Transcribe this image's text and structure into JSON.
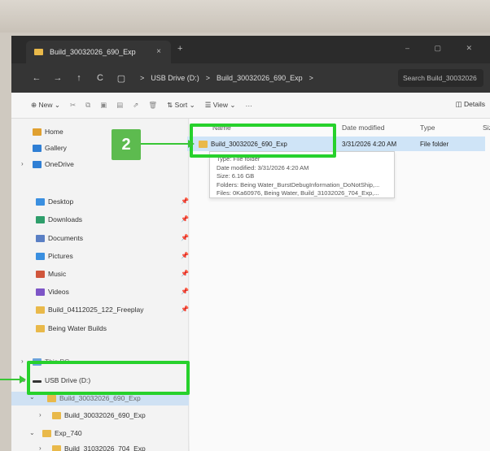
{
  "window": {
    "tab_title": "Build_30032026_690_Exp",
    "tab_close": "×",
    "new_tab": "+",
    "controls": "–  ▢  ✕"
  },
  "address": {
    "back": "←",
    "forward": "→",
    "up": "↑",
    "refresh": "C",
    "monitor": "▢",
    "crumbs": [
      ">",
      "USB Drive (D:)",
      ">",
      "Build_30032026_690_Exp",
      ">"
    ],
    "search_placeholder": "Search Build_30032026"
  },
  "toolbar": {
    "new_label": "New",
    "sort_label": "Sort",
    "view_label": "View",
    "more_label": "···",
    "details_label": "Details"
  },
  "sidebar": {
    "home": "Home",
    "gallery": "Gallery",
    "onedrive": "OneDrive",
    "quick": [
      {
        "label": "Desktop",
        "color": "#3a8fe0"
      },
      {
        "label": "Downloads",
        "color": "#2e9e6b"
      },
      {
        "label": "Documents",
        "color": "#5a7fc4"
      },
      {
        "label": "Pictures",
        "color": "#3a8fe0"
      },
      {
        "label": "Music",
        "color": "#d0563c"
      },
      {
        "label": "Videos",
        "color": "#7d55c7"
      },
      {
        "label": "Build_04112025_122_Freeplay",
        "color": "#e9b94a"
      },
      {
        "label": "Being Water Builds",
        "color": "#e9b94a"
      }
    ],
    "this_pc": "This PC",
    "usb": "USB Drive (D:)",
    "usb_child": "Build_30032026_690_Exp",
    "usb_child2": "Build_30032026_690_Exp",
    "exp740": "Exp_740",
    "build704": "Build_31032026_704_Exp"
  },
  "columns": {
    "name": "Name",
    "date": "Date modified",
    "type": "Type",
    "size": "Size"
  },
  "file_row": {
    "name": "Build_30032026_690_Exp",
    "date": "3/31/2026 4:20 AM",
    "type": "File folder"
  },
  "tooltip": {
    "type": "Type: File folder",
    "date": "Date modified: 3/31/2026 4:20 AM",
    "size": "Size: 6.16 GB",
    "folders": "Folders: Being Water_BurstDebugInformation_DoNotShip,...",
    "files": "Files: 0Ka60976, Being Water, Build_31032026_704_Exp,..."
  },
  "annotation": {
    "badge": "2",
    "color": "#27d12c"
  }
}
